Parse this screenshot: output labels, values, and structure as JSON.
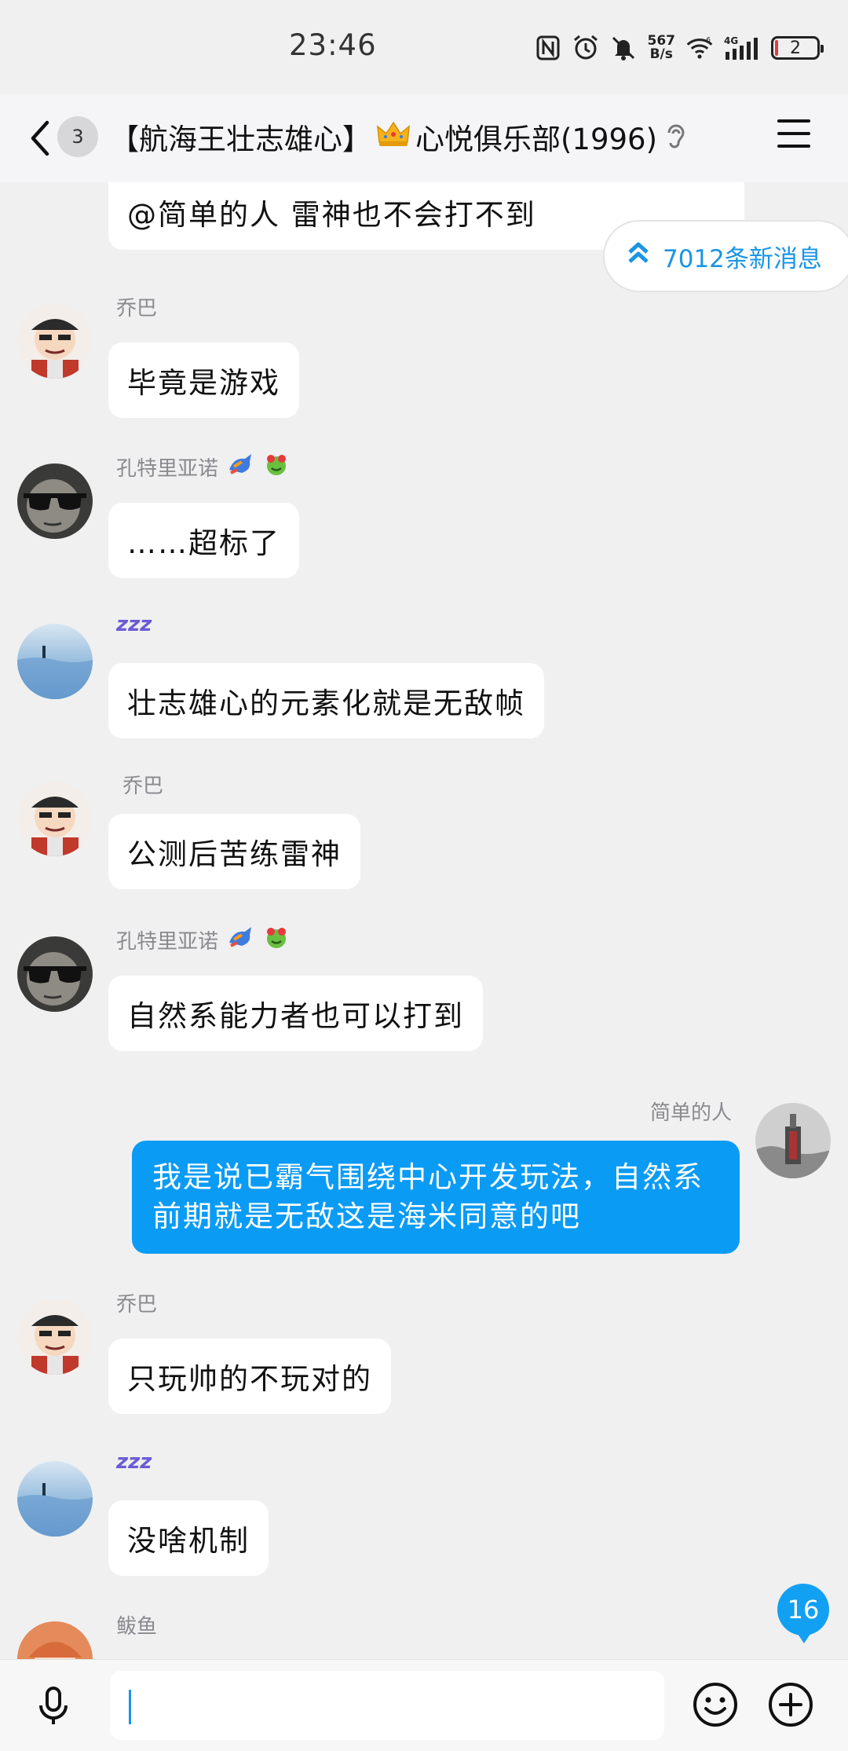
{
  "status_bar": {
    "time": "23:46",
    "net_speed_value": "567",
    "net_speed_unit": "B/s",
    "network": "4G",
    "sim": "6",
    "battery": "2"
  },
  "header": {
    "unread_count": "3",
    "title_part1": "【航海王壮志雄心】",
    "title_part2": "心悦俱乐部(1996)"
  },
  "new_messages": {
    "label": "7012条新消息"
  },
  "messages": [
    {
      "sender": "",
      "text": "@简单的人 雷神也不会打不到"
    },
    {
      "sender": "乔巴",
      "text": "毕竟是游戏"
    },
    {
      "sender": "孔特里亚诺",
      "text": "……超标了"
    },
    {
      "sender": "zzz",
      "text": "壮志雄心的元素化就是无敌帧"
    },
    {
      "sender": "乔巴",
      "text": "公测后苦练雷神"
    },
    {
      "sender": "孔特里亚诺",
      "text": "自然系能力者也可以打到"
    },
    {
      "sender": "简单的人",
      "text": "我是说已霸气围绕中心开发玩法，自然系前期就是无敌这是海米同意的吧"
    },
    {
      "sender": "乔巴",
      "text": "只玩帅的不玩对的"
    },
    {
      "sender": "zzz",
      "text": "没啥机制"
    },
    {
      "sender": "鲅鱼",
      "text": ""
    }
  ],
  "floating_counter": "16",
  "input": {
    "value": ""
  },
  "colors": {
    "accent": "#0a9bf5",
    "bg": "#f0f0f1",
    "bubble": "#ffffff"
  }
}
